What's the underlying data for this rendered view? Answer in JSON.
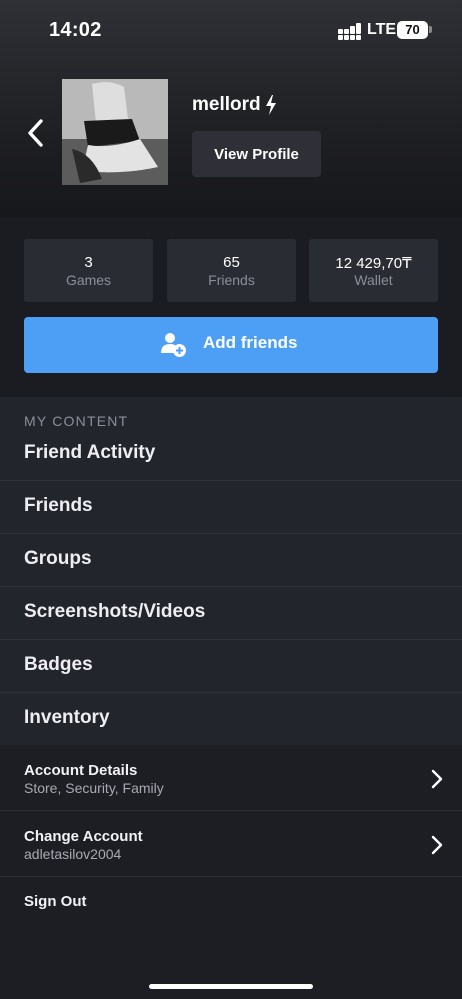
{
  "status_bar": {
    "time": "14:02",
    "network": "LTE",
    "battery": "70"
  },
  "profile": {
    "username": "mellord",
    "status_icon": "lightning-bolt-icon",
    "view_profile_label": "View Profile",
    "avatar": "profile-photo"
  },
  "stats": [
    {
      "value": "3",
      "label": "Games"
    },
    {
      "value": "65",
      "label": "Friends"
    },
    {
      "value": "12 429,70₸",
      "label": "Wallet"
    }
  ],
  "add_friends": {
    "label": "Add friends",
    "icon": "add-user-icon"
  },
  "my_content": {
    "title": "MY CONTENT",
    "items": [
      {
        "label": "Friend Activity"
      },
      {
        "label": "Friends"
      },
      {
        "label": "Groups"
      },
      {
        "label": "Screenshots/Videos"
      },
      {
        "label": "Badges"
      },
      {
        "label": "Inventory"
      }
    ]
  },
  "account": {
    "details_title": "Account Details",
    "details_sub": "Store, Security, Family",
    "change_title": "Change Account",
    "change_sub": "adletasilov2004",
    "sign_out": "Sign Out"
  },
  "colors": {
    "accent": "#4d9ef5",
    "background": "#23252d",
    "header": "#1c1d21",
    "card": "#2a2c33",
    "muted_text": "#8b8e99"
  }
}
